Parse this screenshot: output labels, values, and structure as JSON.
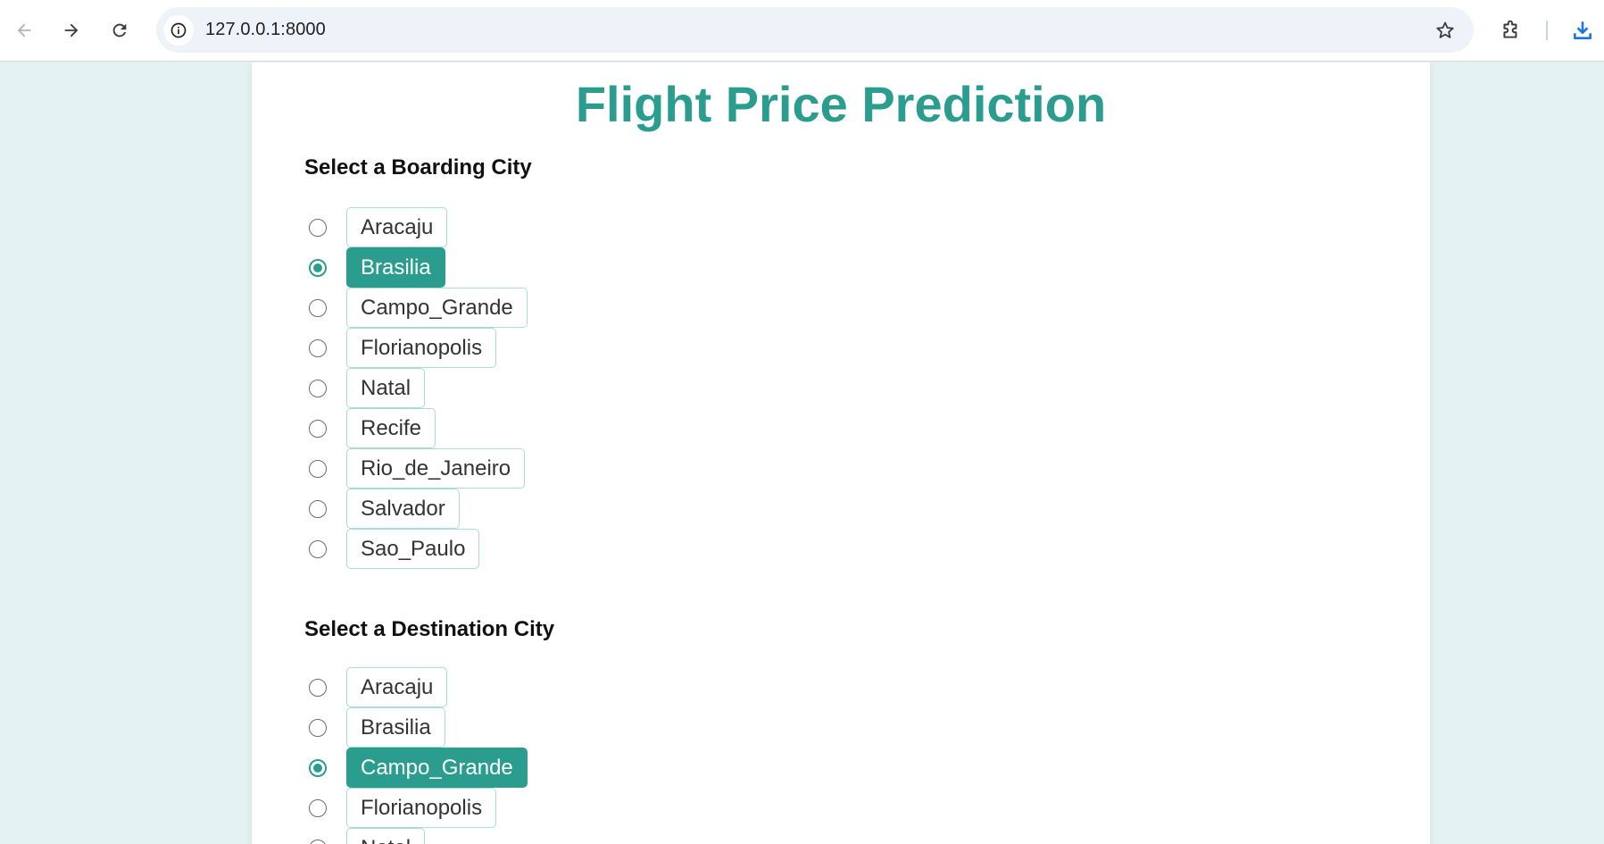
{
  "browser": {
    "url": "127.0.0.1:8000",
    "accent": "#1a73e8"
  },
  "page": {
    "title": "Flight Price Prediction",
    "accent_color": "#2a9d8f"
  },
  "boarding": {
    "heading": "Select a Boarding City",
    "selected": "Brasilia",
    "cities": [
      "Aracaju",
      "Brasilia",
      "Campo_Grande",
      "Florianopolis",
      "Natal",
      "Recife",
      "Rio_de_Janeiro",
      "Salvador",
      "Sao_Paulo"
    ]
  },
  "destination": {
    "heading": "Select a Destination City",
    "selected": "Campo_Grande",
    "cities": [
      "Aracaju",
      "Brasilia",
      "Campo_Grande",
      "Florianopolis",
      "Natal"
    ]
  }
}
